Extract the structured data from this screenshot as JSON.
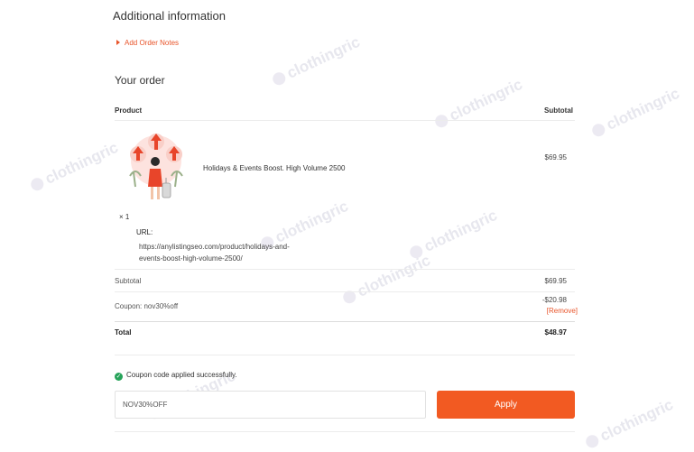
{
  "colors": {
    "accent": "#f25a22",
    "link": "#e8542a",
    "success": "#27a35a"
  },
  "additional_info": {
    "heading": "Additional information",
    "add_notes_label": "Add Order Notes"
  },
  "order": {
    "heading": "Your order",
    "col_product": "Product",
    "col_subtotal": "Subtotal",
    "item": {
      "name": "Holidays & Events Boost. High Volume 2500",
      "price": "$69.95",
      "qty": "× 1",
      "url_label": "URL:",
      "url_value": "https://anylistingseo.com/product/holidays-and-events-boost-high-volume-2500/"
    },
    "subtotal_label": "Subtotal",
    "subtotal_value": "$69.95",
    "coupon_label": "Coupon: nov30%off",
    "coupon_value": "-$20.98",
    "remove_label": "[Remove]",
    "total_label": "Total",
    "total_value": "$48.97"
  },
  "coupon": {
    "success_message": "Coupon code applied successfully.",
    "input_value": "NOV30%OFF",
    "apply_label": "Apply"
  },
  "watermark": "clothingric"
}
